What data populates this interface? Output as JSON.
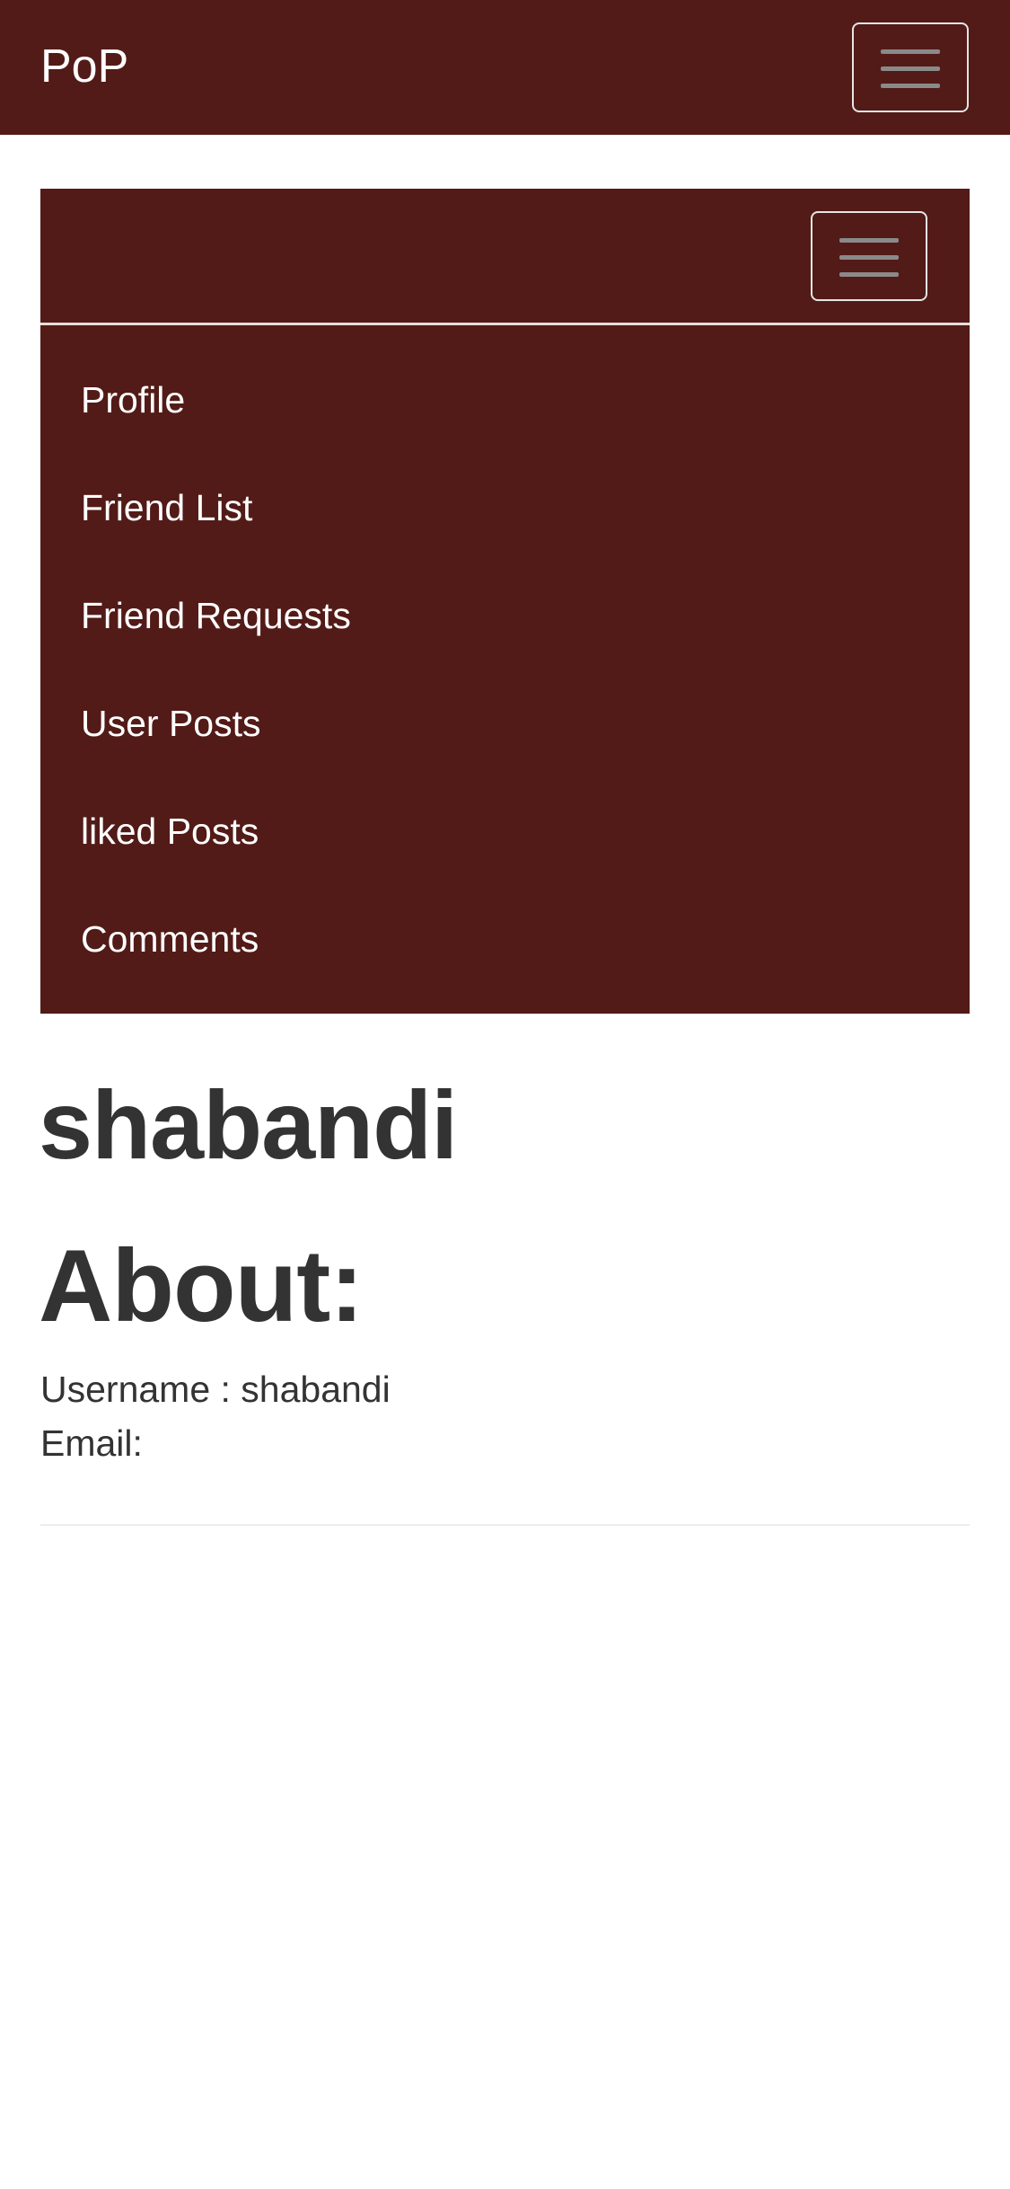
{
  "navbar": {
    "brand": "PoP",
    "toggle_icon": "hamburger-icon"
  },
  "sidebar": {
    "toggle_icon": "hamburger-icon",
    "items": [
      {
        "label": "Profile"
      },
      {
        "label": "Friend List"
      },
      {
        "label": "Friend Requests"
      },
      {
        "label": "User Posts"
      },
      {
        "label": "liked Posts"
      },
      {
        "label": "Comments"
      }
    ]
  },
  "profile": {
    "display_name": "shabandi",
    "about_heading": "About:",
    "username_line": "Username : shabandi",
    "email_line": "Email:"
  },
  "colors": {
    "navbar_bg": "#521b17",
    "text": "#333333"
  }
}
